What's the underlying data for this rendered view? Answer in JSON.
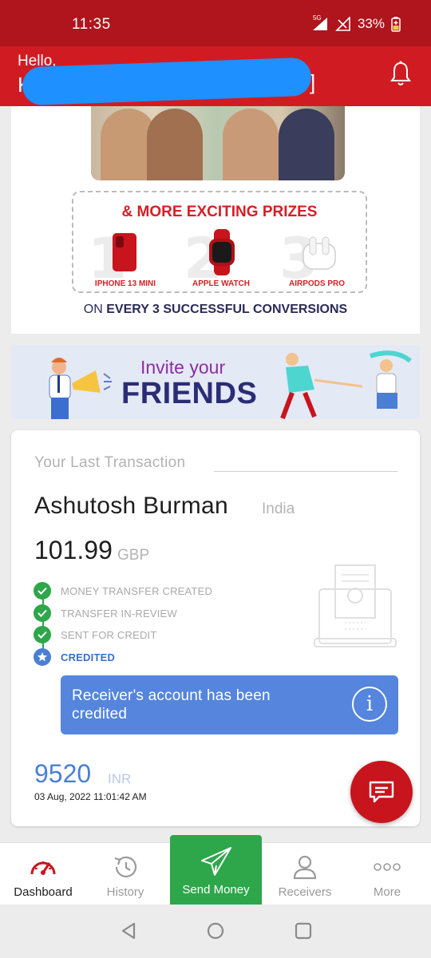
{
  "status_bar": {
    "time": "11:35",
    "network": "5G",
    "battery": "33%"
  },
  "header": {
    "greeting": "Hello,",
    "user_name": "Kiri",
    "user_name_suffix": "]"
  },
  "promo": {
    "title": "& MORE EXCITING PRIZES",
    "prizes": [
      {
        "rank": "1",
        "label": "IPHONE 13 MINI"
      },
      {
        "rank": "2",
        "label": "APPLE WATCH"
      },
      {
        "rank": "3",
        "label": "AIRPODS PRO"
      }
    ],
    "footer_prefix": "ON ",
    "footer_bold": "EVERY 3 SUCCESSFUL CONVERSIONS"
  },
  "invite": {
    "line1": "Invite your",
    "line2": "FRIENDS"
  },
  "last_transaction": {
    "heading": "Your Last Transaction",
    "receiver_name": "Ashutosh Burman",
    "receiver_country": "India",
    "sent_amount": "101.99",
    "sent_currency": "GBP",
    "steps": [
      {
        "label": "MONEY TRANSFER CREATED",
        "state": "done"
      },
      {
        "label": "TRANSFER IN-REVIEW",
        "state": "done"
      },
      {
        "label": "SENT FOR CREDIT",
        "state": "done"
      },
      {
        "label": "CREDITED",
        "state": "current"
      }
    ],
    "status_message": "Receiver's account has been credited",
    "received_amount": "9520",
    "received_currency": "INR",
    "datetime": "03 Aug, 2022 11:01:42 AM"
  },
  "bottom_nav": {
    "items": [
      {
        "label": "Dashboard",
        "icon": "speedometer-icon"
      },
      {
        "label": "History",
        "icon": "history-clock-icon"
      },
      {
        "label": "Send Money",
        "icon": "paper-plane-icon"
      },
      {
        "label": "Receivers",
        "icon": "person-icon"
      },
      {
        "label": "More",
        "icon": "more-dots-icon"
      }
    ]
  },
  "colors": {
    "brand_red": "#d11b22",
    "success_green": "#2ea64a",
    "info_blue": "#5585dc"
  }
}
